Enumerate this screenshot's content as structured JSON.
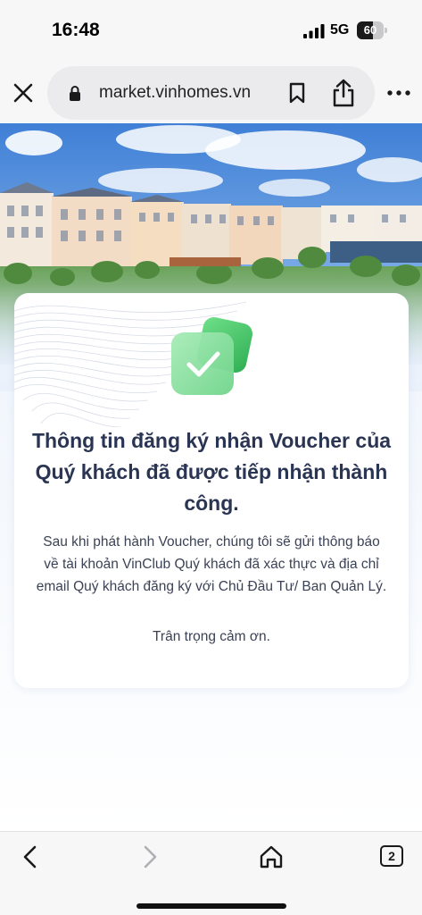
{
  "status_bar": {
    "time": "16:48",
    "network": "5G",
    "battery_percent": 60,
    "battery_label": "60"
  },
  "browser": {
    "url": "market.vinhomes.vn",
    "tab_count": "2"
  },
  "card": {
    "title": "Thông tin đăng ký nhận Voucher của Quý khách đã được tiếp nhận thành công.",
    "body": "Sau khi phát hành Voucher, chúng tôi sẽ gửi thông báo về tài khoản VinClub Quý khách đã xác thực và địa chỉ email Quý khách đăng ký với Chủ Đầu Tư/ Ban Quản Lý.",
    "thanks": "Trân trọng cảm ơn."
  },
  "icons": {
    "close": "close-icon",
    "lock": "lock-icon",
    "bookmark": "bookmark-icon",
    "share": "share-icon",
    "more": "more-icon",
    "check": "check-icon",
    "back": "chevron-left-icon",
    "forward": "chevron-right-icon",
    "home": "home-icon",
    "tabs": "tabs-icon"
  },
  "colors": {
    "accent_green": "#4cc36a",
    "title_text": "#2a3553",
    "body_text": "#3b4256"
  }
}
